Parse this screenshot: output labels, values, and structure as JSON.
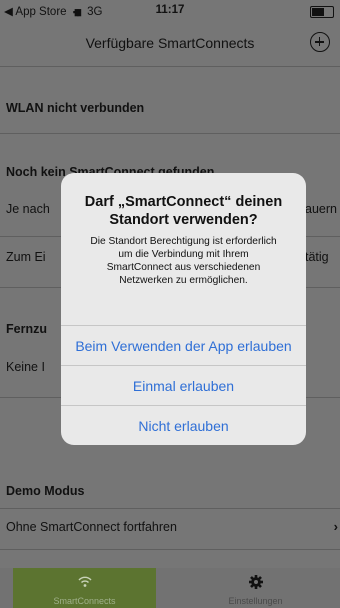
{
  "status_bar": {
    "back_label": "◀ App Store",
    "signal": "▪▮▮",
    "network": "3G",
    "time": "11:17"
  },
  "nav": {
    "title": "Verfügbare SmartConnects"
  },
  "content": {
    "wlan_status": "WLAN nicht verbunden",
    "no_device_title": "Noch kein SmartConnect gefunden",
    "row1_text": "Je nach",
    "row1_trailing": "auern",
    "row2_text": "Zum Ei",
    "row2_trailing": "tätig",
    "remote_title": "Fernzu",
    "remote_text": "Keine I",
    "demo_title": "Demo Modus",
    "demo_row_label": "Ohne SmartConnect fortfahren",
    "demo_row_chevron": "›"
  },
  "tabbar": {
    "tab1_label": "SmartConnects",
    "tab2_label": "Einstellungen",
    "tab1_icon": "wifi-icon",
    "tab2_icon": "gear-icon"
  },
  "alert": {
    "title": "Darf „SmartConnect“ deinen Standort verwenden?",
    "message": "Die Standort Berechtigung ist erforderlich um die Verbindung mit Ihrem SmartConnect aus verschiedenen Netzwerken zu ermöglichen.",
    "btn_while_using": "Beim Verwenden der App erlauben",
    "btn_once": "Einmal erlauben",
    "btn_deny": "Nicht erlauben"
  }
}
